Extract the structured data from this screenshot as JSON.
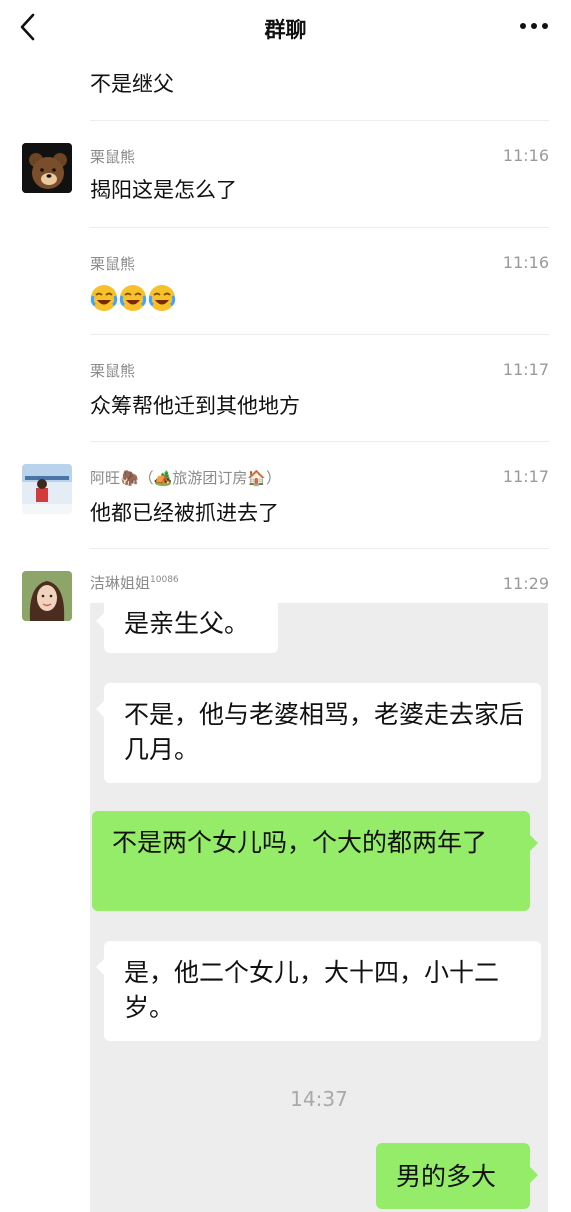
{
  "header": {
    "title": "群聊"
  },
  "messages": [
    {
      "text": "不是继父"
    },
    {
      "sender": "栗鼠熊",
      "time": "11:16",
      "text": "揭阳这是怎么了"
    },
    {
      "sender": "栗鼠熊",
      "time": "11:16",
      "text": ""
    },
    {
      "sender": "栗鼠熊",
      "time": "11:17",
      "text": "众筹帮他迁到其他地方"
    },
    {
      "sender": "阿旺🦣（🏕️旅游团订房🏠）",
      "time": "11:17",
      "text": "他都已经被抓进去了"
    },
    {
      "sender": "洁琳姐姐",
      "sender_sup": "10086",
      "time": "11:29"
    }
  ],
  "screenshot": {
    "bubbles": [
      {
        "side": "left",
        "text": "是亲生父。"
      },
      {
        "side": "left",
        "text": "不是，他与老婆相骂，老婆走去家后几月。"
      },
      {
        "side": "right",
        "text": "不是两个女儿吗，个大的都两年了"
      },
      {
        "side": "left",
        "text": "是，他二个女儿，大十四，小十二岁。"
      },
      {
        "side": "right",
        "text": "男的多大"
      }
    ],
    "timestamp": "14:37"
  },
  "emoji_name": "crying-laughing-emoji",
  "colors": {
    "accent_green": "#95ec69",
    "screenshot_bg": "#ededed"
  }
}
